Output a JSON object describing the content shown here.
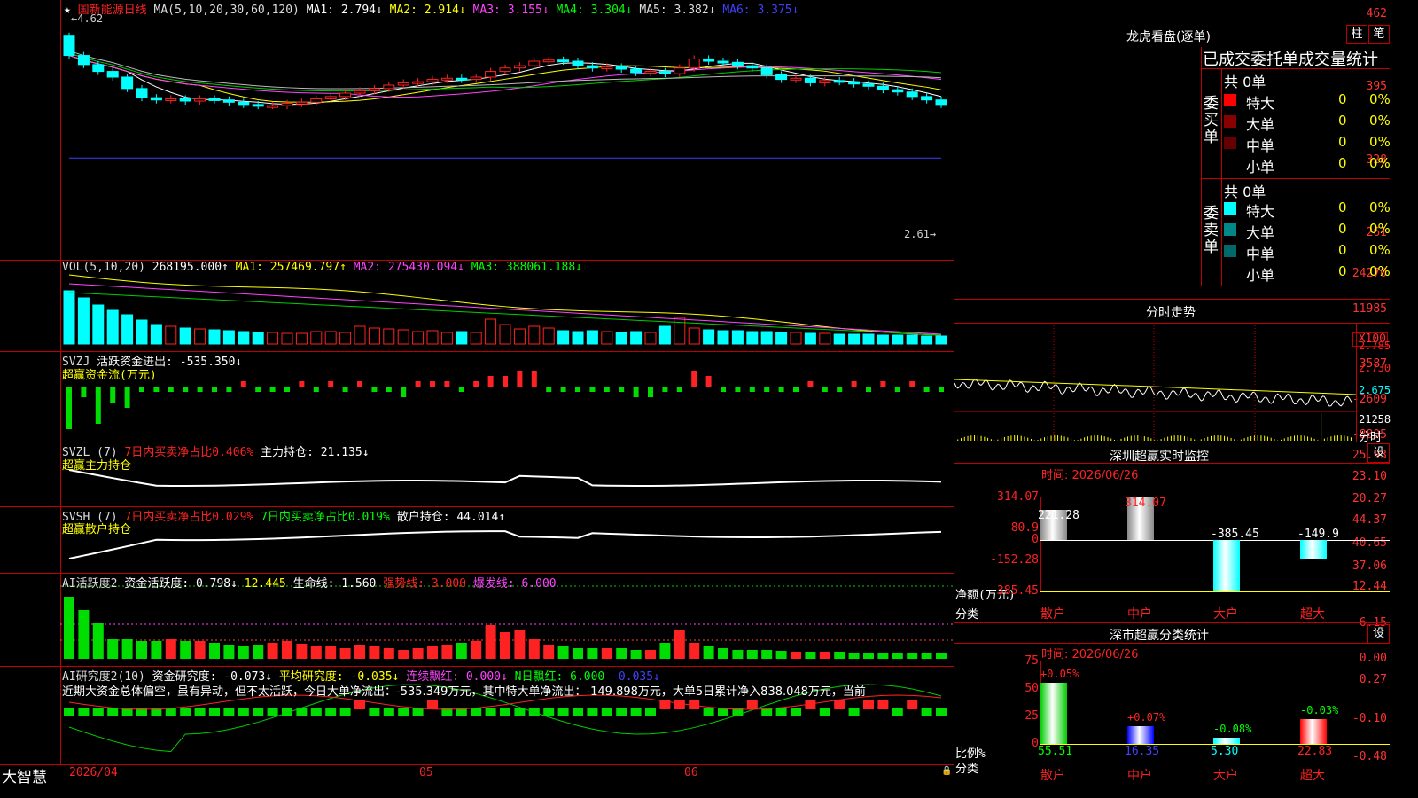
{
  "app": {
    "logo": "大智慧"
  },
  "kline": {
    "stock": "国新能源",
    "period": "日线",
    "ma_label": "MA(5,10,20,30,60,120)",
    "ma": [
      {
        "t": "MA1: 2.794↓",
        "c": "#ffffff"
      },
      {
        "t": "MA2: 2.914↓",
        "c": "#ffff00"
      },
      {
        "t": "MA3: 3.155↓",
        "c": "#ff44ff"
      },
      {
        "t": "MA4: 3.304↓",
        "c": "#00ff00"
      },
      {
        "t": "MA5: 3.382↓",
        "c": "#dddddd"
      },
      {
        "t": "MA6: 3.375↓",
        "c": "#4040ff"
      }
    ],
    "high_mark": "4.62",
    "low_mark": "2.61",
    "ylabels": [
      "462",
      "395",
      "328",
      "261"
    ]
  },
  "vol": {
    "label": "VOL(5,10,20)",
    "value": "268195.000↑",
    "ma": [
      {
        "t": "MA1: 257469.797↑",
        "c": "#ffff00"
      },
      {
        "t": "MA2: 275430.094↓",
        "c": "#ff44ff"
      },
      {
        "t": "MA3: 388061.188↓",
        "c": "#00ff00"
      }
    ],
    "ylabels": [
      "24270",
      "11985"
    ],
    "unit": "X100"
  },
  "svzj": {
    "label": "SVZJ",
    "text": "活跃资金进出: -535.350↓",
    "sub": "超赢资金流(万元)",
    "ylabels": [
      "3587",
      "-2609",
      "-8805"
    ]
  },
  "svzl": {
    "label": "SVZL (7)",
    "t1": "7日内买卖净占比0.406%",
    "t2": "主力持仓: 21.135↓",
    "sub": "超赢主力持仓",
    "ylabels": [
      "25.93",
      "23.10",
      "20.27"
    ]
  },
  "svsh": {
    "label": "SVSH (7)",
    "t1": "7日内买卖净占比0.029%",
    "t2": "7日内买卖净占比0.019%",
    "t3": "散户持仓: 44.014↑",
    "sub": "超赢散户持仓",
    "ylabels": [
      "44.37",
      "40.65",
      "37.06"
    ]
  },
  "ai1": {
    "label": "AI活跃度2",
    "t1": "资金活跃度: 0.798↓",
    "t2": "12.445",
    "t3": "生命线: 1.560",
    "t4": "强势线: 3.000",
    "t5": "爆发线: 6.000",
    "ylabels": [
      "12.44",
      "6.15",
      "0.00"
    ]
  },
  "ai2": {
    "label": "AI研究度2(10)",
    "t1": "资金研究度: -0.073↓",
    "t2": "平均研究度: -0.035↓",
    "t3": "连续飘红: 0.000↓",
    "t4": "N日飘红: 6.000",
    "t5": "-0.035↓",
    "desc": "近期大资金总体偏空，虽有异动，但不太活跃，今日大单净流出：-535.349万元，其中特大单净流出：-149.898万元，大单5日累计净入838.048万元，当前",
    "ylabels": [
      "0.27",
      "-0.10",
      "-0.48"
    ]
  },
  "xaxis": {
    "labels": [
      "2026/04",
      "05",
      "06"
    ]
  },
  "lhb": {
    "title": "龙虎看盘(逐单)",
    "btn1": "柱",
    "btn2": "笔",
    "header": "已成交委托单成交量统计",
    "buy": {
      "side": "委买单",
      "total": "共 0单",
      "rows": [
        {
          "name": "特大",
          "v": "0",
          "p": "0%",
          "c": "#ff0000"
        },
        {
          "name": "大单",
          "v": "0",
          "p": "0%",
          "c": "#880000"
        },
        {
          "name": "中单",
          "v": "0",
          "p": "0%",
          "c": "#660000"
        },
        {
          "name": "小单",
          "v": "0",
          "p": "0%",
          "c": "#000000"
        }
      ]
    },
    "sell": {
      "side": "委卖单",
      "total": "共 0单",
      "rows": [
        {
          "name": "特大",
          "v": "0",
          "p": "0%",
          "c": "#00ffff"
        },
        {
          "name": "大单",
          "v": "0",
          "p": "0%",
          "c": "#008888"
        },
        {
          "name": "中单",
          "v": "0",
          "p": "0%",
          "c": "#006a6a"
        },
        {
          "name": "小单",
          "v": "0",
          "p": "0%",
          "c": "#000000"
        }
      ]
    }
  },
  "fenshi": {
    "title": "分时走势",
    "ylabels": [
      "2.785",
      "2.730",
      "2.675",
      "21258",
      "分时"
    ]
  },
  "sz_rt": {
    "title": "深圳超赢实时监控",
    "set": "设",
    "time": "时间: 2026/06/26",
    "ylabels": [
      "314.07",
      "80.9",
      "0",
      "-152.28",
      "-385.45"
    ],
    "ylabel_name": "净额(万元)",
    "xlabel_name": "分类",
    "cats": [
      "散户",
      "中户",
      "大户",
      "超大"
    ],
    "values": [
      "221.28",
      "314.07",
      "-385.45",
      "-149.9"
    ],
    "chart_data": {
      "type": "bar",
      "categories": [
        "散户",
        "中户",
        "大户",
        "超大"
      ],
      "values": [
        221.28,
        314.07,
        -385.45,
        -149.9
      ],
      "ylabel": "净额(万元)",
      "ylim": [
        -385.45,
        314.07
      ]
    }
  },
  "sz_cls": {
    "title": "深市超赢分类统计",
    "set": "设",
    "time": "时间: 2026/06/26",
    "ylabels": [
      "75",
      "50",
      "25",
      "0"
    ],
    "ylabel_name": "比例%",
    "xlabel_name": "分类",
    "cats": [
      "散户",
      "中户",
      "大户",
      "超大"
    ],
    "values": [
      "55.51",
      "16.35",
      "5.30",
      "22.83"
    ],
    "changes": [
      "+0.05%",
      "+0.07%",
      "-0.08%",
      "-0.03%"
    ],
    "chart_data": {
      "type": "bar",
      "categories": [
        "散户",
        "中户",
        "大户",
        "超大"
      ],
      "values": [
        55.51,
        16.35,
        5.3,
        22.83
      ],
      "ylabel": "比例%",
      "ylim": [
        0,
        75
      ]
    }
  }
}
